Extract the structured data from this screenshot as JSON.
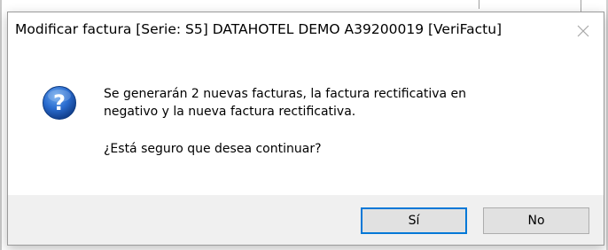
{
  "dialog": {
    "title": "Modificar factura [Serie: S5] DATAHOTEL DEMO A39200019 [VeriFactu]",
    "close_icon": "close-icon",
    "icon": "question-icon",
    "message_line1": "Se generarán 2 nuevas facturas, la factura rectificativa en",
    "message_line2": "negativo y la nueva factura rectificativa.",
    "question": "¿Está seguro que desea continuar?",
    "buttons": {
      "yes": "Sí",
      "no": "No"
    }
  },
  "colors": {
    "icon_blue": "#1f5fb4",
    "focus_border": "#0078d7",
    "footer_bg": "#f0f0f0",
    "button_bg": "#e1e1e1"
  }
}
